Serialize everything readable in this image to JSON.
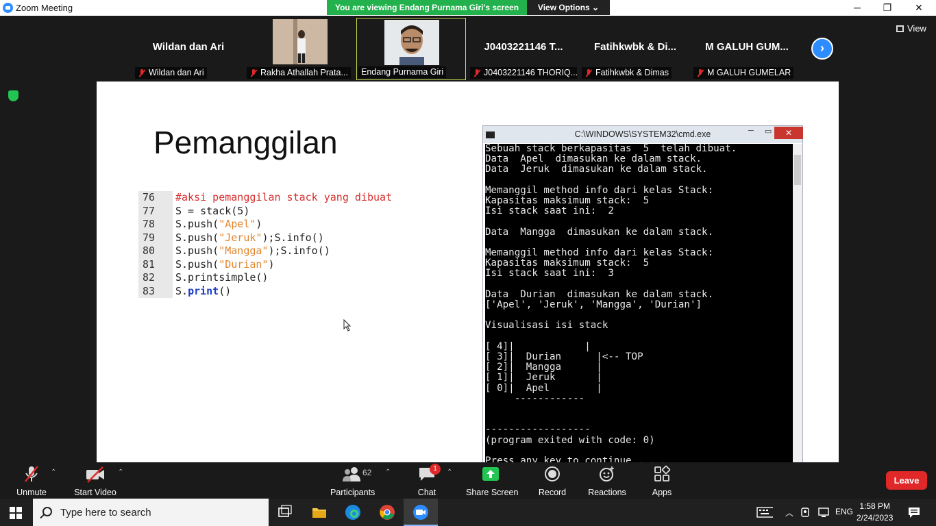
{
  "window": {
    "title": "Zoom Meeting",
    "minimize": "─",
    "restore": "❐",
    "close": "✕"
  },
  "banner": {
    "text": "You are viewing Endang Purnama Giri's screen",
    "view_options": "View Options ⌄"
  },
  "gallery": {
    "tiles": [
      {
        "big_name": "Wildan dan Ari",
        "name": "Wildan dan Ari",
        "video": false
      },
      {
        "big_name": "",
        "name": "Rakha Athallah Prata...",
        "video": true
      },
      {
        "big_name": "",
        "name": "Endang Purnama Giri",
        "video": true,
        "active": true
      },
      {
        "big_name": "J0403221146 T...",
        "name": "J0403221146 THORIQ...",
        "video": false
      },
      {
        "big_name": "Fatihkwbk & Di...",
        "name": "Fatihkwbk & Dimas",
        "video": false
      },
      {
        "big_name": "M GALUH GUM...",
        "name": "M GALUH GUMELAR",
        "video": false
      }
    ],
    "next_icon": "›",
    "view_label": "View"
  },
  "slide": {
    "title": "Pemanggilan",
    "code": [
      {
        "ln": "76",
        "parts": [
          {
            "t": "#aksi pemanggilan stack yang dibuat",
            "c": "cm"
          }
        ]
      },
      {
        "ln": "77",
        "parts": [
          {
            "t": "S = stack(5)",
            "c": ""
          }
        ]
      },
      {
        "ln": "78",
        "parts": [
          {
            "t": "S.push(",
            "c": ""
          },
          {
            "t": "\"Apel\"",
            "c": "str"
          },
          {
            "t": ")",
            "c": ""
          }
        ]
      },
      {
        "ln": "79",
        "parts": [
          {
            "t": "S.push(",
            "c": ""
          },
          {
            "t": "\"Jeruk\"",
            "c": "str"
          },
          {
            "t": ");S.info()",
            "c": ""
          }
        ]
      },
      {
        "ln": "80",
        "parts": [
          {
            "t": "S.push(",
            "c": ""
          },
          {
            "t": "\"Mangga\"",
            "c": "str"
          },
          {
            "t": ");S.info()",
            "c": ""
          }
        ]
      },
      {
        "ln": "81",
        "parts": [
          {
            "t": "S.push(",
            "c": ""
          },
          {
            "t": "\"Durian\"",
            "c": "str"
          },
          {
            "t": ")",
            "c": ""
          }
        ]
      },
      {
        "ln": "82",
        "parts": [
          {
            "t": "S.printsimple()",
            "c": ""
          }
        ]
      },
      {
        "ln": "83",
        "parts": [
          {
            "t": "S.",
            "c": ""
          },
          {
            "t": "print",
            "c": "kw"
          },
          {
            "t": "()",
            "c": ""
          }
        ]
      }
    ]
  },
  "cmd": {
    "title": "C:\\WINDOWS\\SYSTEM32\\cmd.exe",
    "minimize": "─",
    "maximize": "▭",
    "close": "✕",
    "output": "Sebuah stack berkapasitas  5  telah dibuat.\nData  Apel  dimasukan ke dalam stack.\nData  Jeruk  dimasukan ke dalam stack.\n\nMemanggil method info dari kelas Stack:\nKapasitas maksimum stack:  5\nIsi stack saat ini:  2\n\nData  Mangga  dimasukan ke dalam stack.\n\nMemanggil method info dari kelas Stack:\nKapasitas maksimum stack:  5\nIsi stack saat ini:  3\n\nData  Durian  dimasukan ke dalam stack.\n['Apel', 'Jeruk', 'Mangga', 'Durian']\n\nVisualisasi isi stack\n\n[ 4]|            |\n[ 3]|  Durian      |<-- TOP\n[ 2]|  Mangga      |\n[ 1]|  Jeruk       |\n[ 0]|  Apel        |\n     ------------\n\n\n------------------\n(program exited with code: 0)\n\nPress any key to continue . . ."
  },
  "controls": {
    "unmute": "Unmute",
    "start_video": "Start Video",
    "participants": "Participants",
    "participants_count": "62",
    "chat": "Chat",
    "chat_badge": "1",
    "share_screen": "Share Screen",
    "record": "Record",
    "reactions": "Reactions",
    "apps": "Apps",
    "leave": "Leave",
    "caret": "⌃"
  },
  "taskbar": {
    "search_placeholder": "Type here to search",
    "lang": "ENG",
    "time": "1:58 PM",
    "date": "2/24/2023"
  },
  "colors": {
    "zoom_blue": "#2d8cff",
    "banner_green": "#22b14c",
    "leave_red": "#e02828",
    "share_green": "#23c552"
  }
}
